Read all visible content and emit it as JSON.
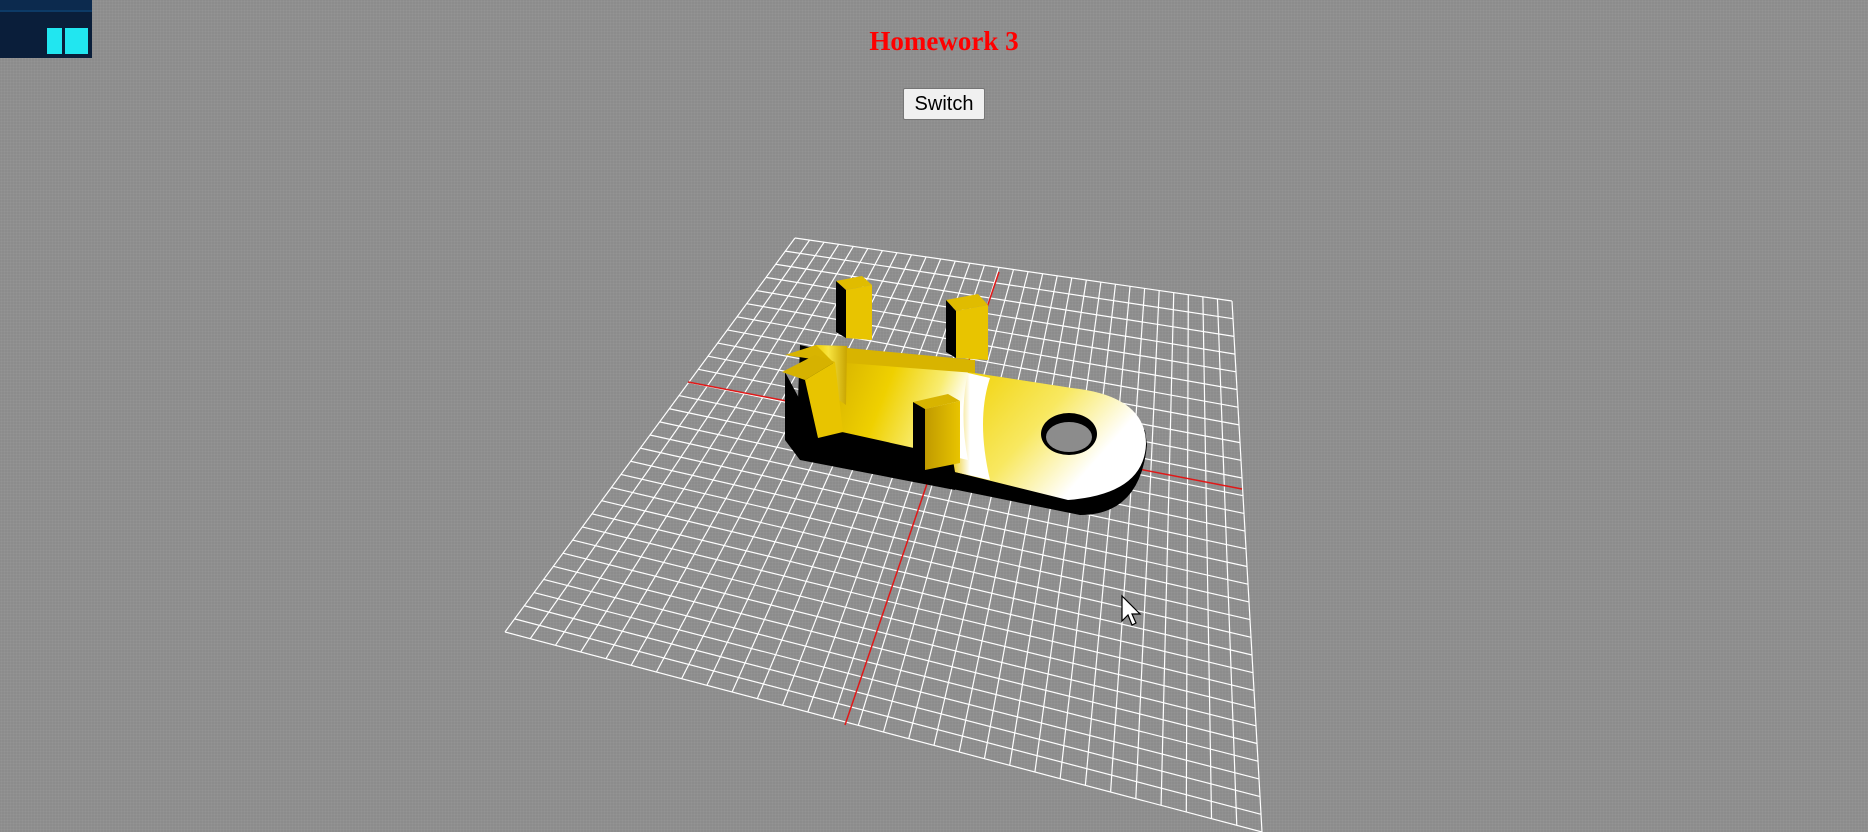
{
  "page": {
    "title": "Homework 3",
    "switch_label": "Switch"
  },
  "stats": {
    "bar_color": "#21e6f0",
    "panel_color": "#0a1e3a"
  },
  "scene": {
    "background_color": "#8c8c8c",
    "grid_color": "#ffffff",
    "axis_color": "#e01818",
    "model_color": "#e8c400",
    "model_shadow_color": "#000000"
  }
}
